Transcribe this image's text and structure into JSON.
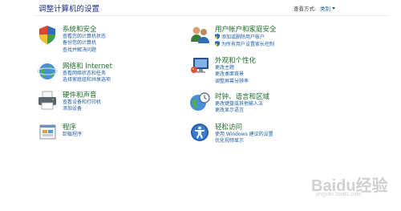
{
  "header": {
    "title": "调整计算机的设置",
    "view_by_label": "查看方式:",
    "view_by_value": "类别"
  },
  "categories": [
    {
      "title": "系统和安全",
      "icon": "shield-icon",
      "links": [
        "查看您的计算机状态",
        "备份您的计算机",
        "查找并解决问题"
      ]
    },
    {
      "title": "用户帐户和家庭安全",
      "icon": "users-icon",
      "links": [
        "添加或删除用户帐户",
        "为所有用户设置家长控制"
      ]
    },
    {
      "title": "网络和 Internet",
      "icon": "network-icon",
      "links": [
        "查看网络状态和任务",
        "选择家庭组和共享选项"
      ]
    },
    {
      "title": "外观和个性化",
      "icon": "appearance-icon",
      "links": [
        "更改主题",
        "更改桌面背景",
        "调整屏幕分辨率"
      ]
    },
    {
      "title": "硬件和声音",
      "icon": "printer-icon",
      "links": [
        "查看设备和打印机",
        "添加设备"
      ]
    },
    {
      "title": "时钟、语言和区域",
      "icon": "clock-globe-icon",
      "links": [
        "更改键盘或其他输入法",
        "更改显示语言"
      ]
    },
    {
      "title": "程序",
      "icon": "programs-icon",
      "links": [
        "卸载程序"
      ]
    },
    {
      "title": "轻松访问",
      "icon": "ease-of-access-icon",
      "links": [
        "使用 Windows 建议的设置",
        "优化视频显示"
      ]
    }
  ],
  "watermark": {
    "text": "Baidu经验",
    "url": "jingyan.baidu.com"
  },
  "colors": {
    "title_blue": "#1e3287",
    "category_green": "#1e6e2e",
    "link_blue": "#1e5ea8"
  }
}
